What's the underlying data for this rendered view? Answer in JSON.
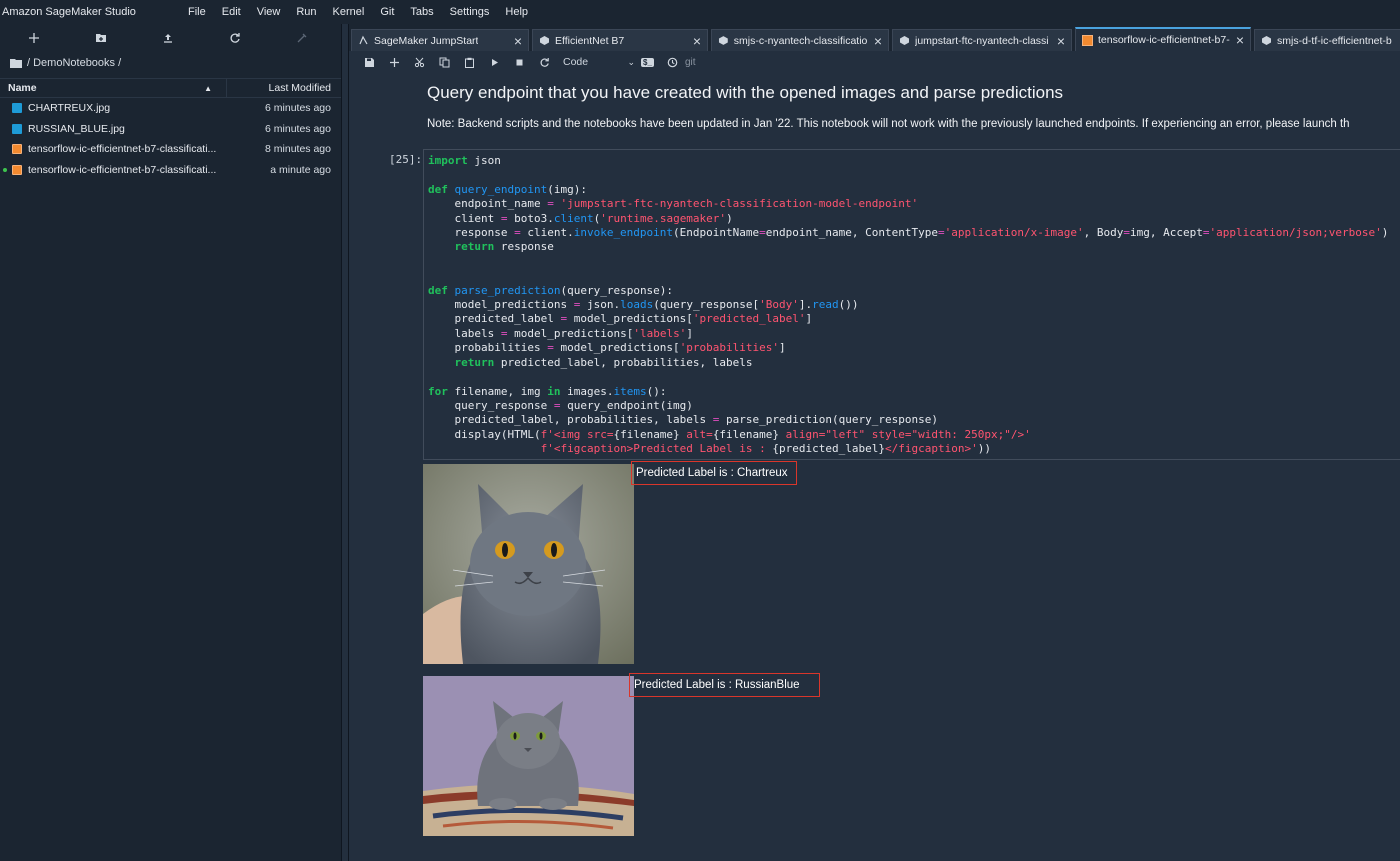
{
  "app": {
    "title": "Amazon SageMaker Studio"
  },
  "menu": [
    "File",
    "Edit",
    "View",
    "Run",
    "Kernel",
    "Git",
    "Tabs",
    "Settings",
    "Help"
  ],
  "file_browser": {
    "breadcrumb": "/ DemoNotebooks /",
    "columns": {
      "name": "Name",
      "modified": "Last Modified"
    },
    "files": [
      {
        "name": "CHARTREUX.jpg",
        "modified": "6 minutes ago",
        "type": "image",
        "running": false
      },
      {
        "name": "RUSSIAN_BLUE.jpg",
        "modified": "6 minutes ago",
        "type": "image",
        "running": false
      },
      {
        "name": "tensorflow-ic-efficientnet-b7-classificati...",
        "modified": "8 minutes ago",
        "type": "notebook",
        "running": false
      },
      {
        "name": "tensorflow-ic-efficientnet-b7-classificati...",
        "modified": "a minute ago",
        "type": "notebook",
        "running": true
      }
    ]
  },
  "tabs": [
    {
      "label": "SageMaker JumpStart",
      "active": false
    },
    {
      "label": "EfficientNet B7",
      "active": false
    },
    {
      "label": "smjs-c-nyantech-classificatior",
      "active": false
    },
    {
      "label": "jumpstart-ftc-nyantech-classi",
      "active": false
    },
    {
      "label": "tensorflow-ic-efficientnet-b7-",
      "active": true
    },
    {
      "label": "smjs-d-tf-ic-efficientnet-b",
      "active": false
    }
  ],
  "notebook_toolbar": {
    "cell_type": "Code",
    "git_label": "git",
    "kernel_badge": "$_"
  },
  "notebook": {
    "heading": "Query endpoint that you have created with the opened images and parse predictions",
    "note": "Note: Backend scripts and the notebooks have been updated in Jan '22. This notebook will not work with the previously launched endpoints. If experiencing an error, please launch th",
    "cell_prompt": "[25]:",
    "outputs": [
      {
        "caption": "Predicted Label is : Chartreux"
      },
      {
        "caption": "Predicted Label is : RussianBlue"
      }
    ]
  }
}
